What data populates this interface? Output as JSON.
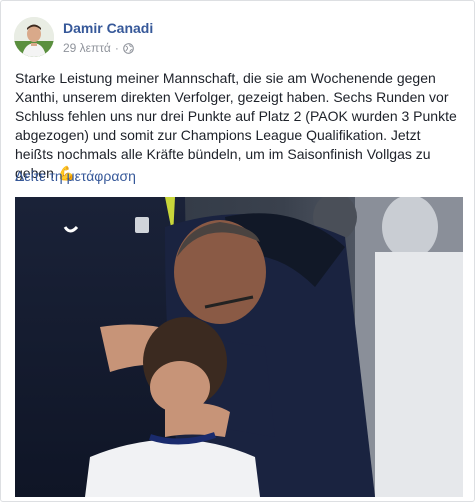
{
  "post": {
    "author": "Damir Canadi",
    "timestamp": "29 λεπτά",
    "separator": "·",
    "audience_icon": "globe-icon",
    "text": "Starke Leistung meiner Mannschaft, die sie am Wochenende gegen Xanthi, unserem direkten Verfolger, gezeigt haben. Sechs Runden vor Schluss fehlen uns nur drei Punkte auf Platz 2 (PAOK wurden 3 Punkte abgezogen) und somit zur Champions League Qualifikation. Jetzt heißts nochmals alle Kräfte bündeln, um im Saisonfinish Vollgas zu geben 💪",
    "translate_link": "Δείτε τη μετάφραση"
  },
  "colors": {
    "link": "#365899",
    "meta": "#90949c",
    "text": "#1d2129",
    "border": "#dddfe2"
  }
}
